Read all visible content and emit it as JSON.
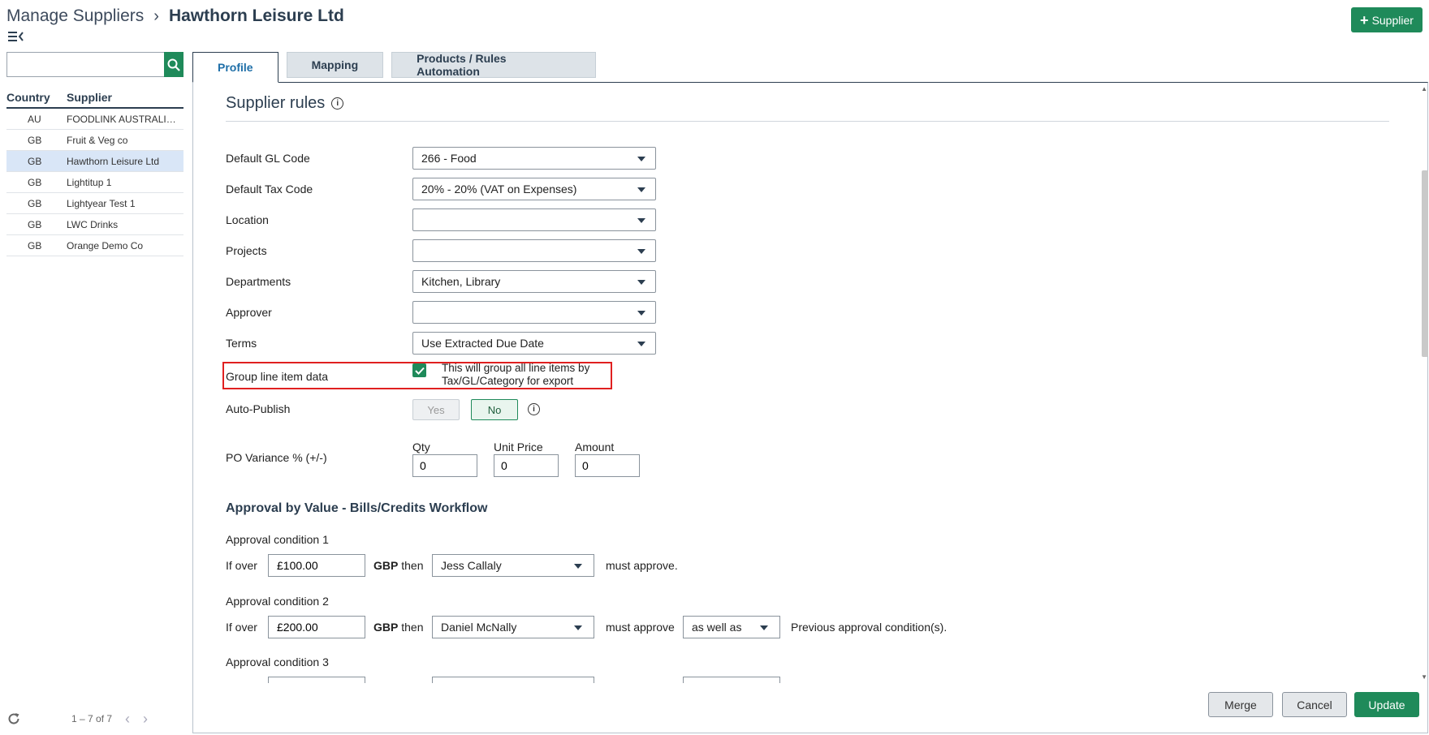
{
  "header": {
    "breadcrumb_parent": "Manage Suppliers",
    "breadcrumb_separator": "›",
    "breadcrumb_current": "Hawthorn Leisure Ltd",
    "add_supplier_label": "Supplier"
  },
  "sidebar": {
    "search_placeholder": "",
    "columns": {
      "country": "Country",
      "supplier": "Supplier"
    },
    "rows": [
      {
        "country": "AU",
        "name": "FOODLINK AUSTRALIA ...",
        "selected": false
      },
      {
        "country": "GB",
        "name": "Fruit & Veg co",
        "selected": false
      },
      {
        "country": "GB",
        "name": "Hawthorn Leisure Ltd",
        "selected": true
      },
      {
        "country": "GB",
        "name": "Lightitup 1",
        "selected": false
      },
      {
        "country": "GB",
        "name": "Lightyear Test 1",
        "selected": false
      },
      {
        "country": "GB",
        "name": "LWC Drinks",
        "selected": false
      },
      {
        "country": "GB",
        "name": "Orange Demo Co",
        "selected": false
      }
    ],
    "pager_text": "1 – 7 of 7"
  },
  "tabs": [
    {
      "label": "Profile",
      "active": true
    },
    {
      "label": "Mapping",
      "active": false
    },
    {
      "label": "Products / Rules Automation",
      "active": false
    }
  ],
  "rules": {
    "section_title": "Supplier rules",
    "default_gl": {
      "label": "Default GL Code",
      "value": "266 - Food"
    },
    "default_tax": {
      "label": "Default Tax Code",
      "value": "20% - 20% (VAT on Expenses)"
    },
    "location": {
      "label": "Location",
      "value": ""
    },
    "projects": {
      "label": "Projects",
      "value": ""
    },
    "departments": {
      "label": "Departments",
      "value": "Kitchen, Library"
    },
    "approver": {
      "label": "Approver",
      "value": ""
    },
    "terms": {
      "label": "Terms",
      "value": "Use Extracted Due Date"
    },
    "group_line": {
      "label": "Group line item data",
      "checked": true,
      "description": "This will group all line items by Tax/GL/Category for export"
    },
    "auto_publish": {
      "label": "Auto-Publish",
      "yes": "Yes",
      "no": "No",
      "selected": "No"
    },
    "po_variance": {
      "label": "PO Variance % (+/-)",
      "qty_label": "Qty",
      "qty_value": "0",
      "unit_price_label": "Unit Price",
      "unit_price_value": "0",
      "amount_label": "Amount",
      "amount_value": "0"
    }
  },
  "approval": {
    "title": "Approval by Value - Bills/Credits Workflow",
    "if_over": "If over",
    "currency": "GBP",
    "then": "then",
    "conditions": [
      {
        "title": "Approval condition 1",
        "amount": "£100.00",
        "approver": "Jess Callaly",
        "must_approve": "must approve.",
        "relation": "",
        "suffix": ""
      },
      {
        "title": "Approval condition 2",
        "amount": "£200.00",
        "approver": "Daniel McNally",
        "must_approve": "must approve",
        "relation": "as well as",
        "suffix": "Previous approval condition(s)."
      },
      {
        "title": "Approval condition 3",
        "amount": "",
        "approver": "",
        "must_approve": "",
        "relation": "",
        "suffix": ""
      }
    ]
  },
  "footer": {
    "merge": "Merge",
    "cancel": "Cancel",
    "update": "Update"
  },
  "colors": {
    "primary_green": "#1f8a5a",
    "heading": "#2c3e50",
    "highlight_red": "#e02020",
    "selected_row": "#d9e6f7"
  }
}
